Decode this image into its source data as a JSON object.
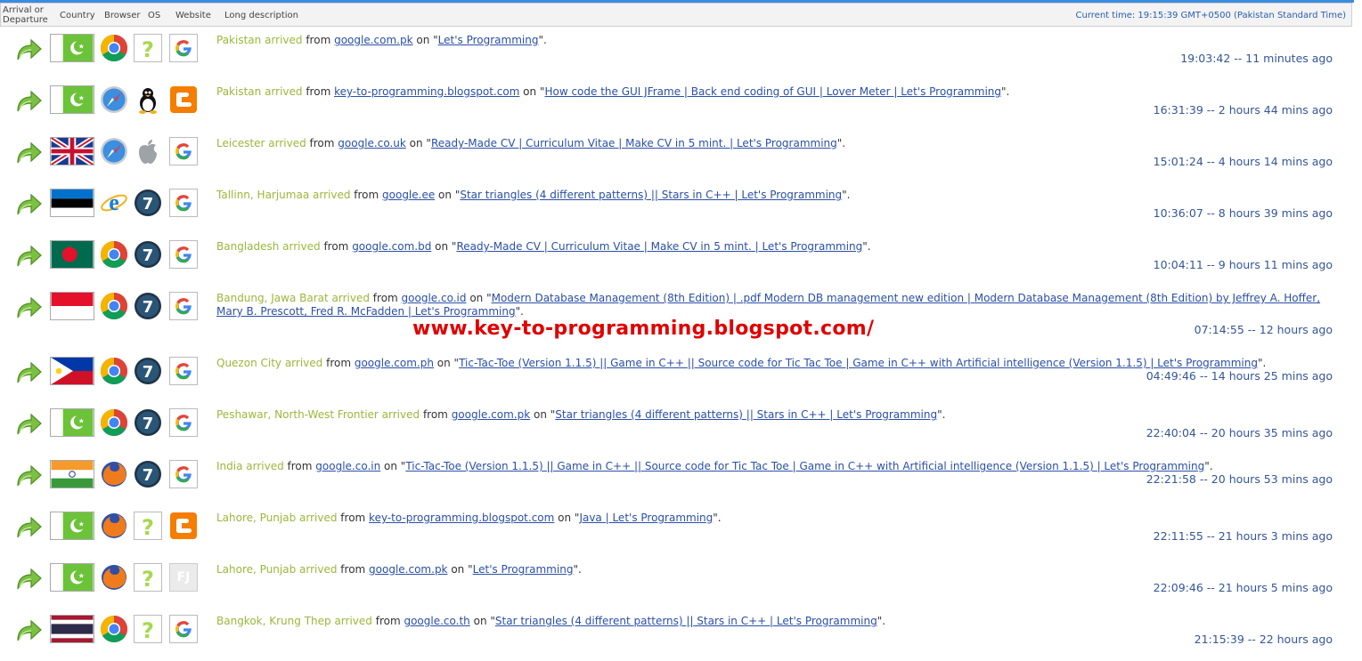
{
  "header": {
    "col_arrival": "Arrival or Departure",
    "col_country": "Country",
    "col_browser": "Browser",
    "col_os": "OS",
    "col_website": "Website",
    "col_description": "Long description",
    "current_time": "Current time: 19:15:39 GMT+0500 (Pakistan Standard Time)"
  },
  "watermark": "www.key-to-programming.blogspot.com/",
  "strings": {
    "arrived": " arrived",
    "from": " from ",
    "on": " on ",
    "quote_open": "\"",
    "quote_close": "\"."
  },
  "colors": {
    "location": "#9ab83a",
    "link": "#2a4fa8",
    "time": "#34559a",
    "watermark": "#e00000"
  },
  "rows": [
    {
      "location": "Pakistan",
      "flag": "pakistan-flag",
      "browser": "chrome-icon",
      "os": "unknown-icon",
      "site": "google-icon",
      "referrer": "google.com.pk",
      "page": "Let's Programming",
      "time": "19:03:42 -- 11 minutes ago"
    },
    {
      "location": "Pakistan",
      "flag": "pakistan-flag",
      "browser": "safari-icon",
      "os": "linux-icon",
      "site": "blogger-icon",
      "referrer": "key-to-programming.blogspot.com",
      "page": "How code the GUI JFrame | Back end coding of GUI | Lover Meter | Let's Programming",
      "time": "16:31:39 -- 2 hours 44 mins ago"
    },
    {
      "location": "Leicester",
      "flag": "uk-flag",
      "browser": "safari-icon",
      "os": "apple-icon",
      "site": "google-icon",
      "referrer": "google.co.uk",
      "page": "Ready-Made CV | Curriculum Vitae | Make CV in 5 mint. | Let's Programming",
      "time": "15:01:24 -- 4 hours 14 mins ago"
    },
    {
      "location": "Tallinn, Harjumaa",
      "flag": "estonia-flag",
      "browser": "ie-icon",
      "os": "windows7-icon",
      "site": "google-icon",
      "referrer": "google.ee",
      "page": "Star triangles (4 different patterns) || Stars in C++ | Let's Programming",
      "time": "10:36:07 -- 8 hours 39 mins ago"
    },
    {
      "location": "Bangladesh",
      "flag": "bangladesh-flag",
      "browser": "chrome-icon",
      "os": "windows7-icon",
      "site": "google-icon",
      "referrer": "google.com.bd",
      "page": "Ready-Made CV | Curriculum Vitae | Make CV in 5 mint. | Let's Programming",
      "time": "10:04:11 -- 9 hours 11 mins ago"
    },
    {
      "location": "Bandung, Jawa Barat",
      "flag": "indonesia-flag",
      "browser": "chrome-icon",
      "os": "windows7-icon",
      "site": "google-icon",
      "referrer": "google.co.id",
      "page": "Modern Database Management (8th Edition) | .pdf Modern DB management new edition | Modern Database Management (8th Edition) by Jeffrey A. Hoffer, Mary B. Prescott, Fred R. McFadden | Let's Programming",
      "time": "07:14:55 -- 12 hours ago"
    },
    {
      "location": "Quezon City",
      "flag": "philippines-flag",
      "browser": "chrome-icon",
      "os": "windows7-icon",
      "site": "google-icon",
      "referrer": "google.com.ph",
      "page": "Tic-Tac-Toe (Version 1.1.5) || Game in C++ || Source code for Tic Tac Toe | Game in C++ with Artificial intelligence (Version 1.1.5) | Let's Programming",
      "time": "04:49:46 -- 14 hours 25 mins ago"
    },
    {
      "location": "Peshawar, North-West Frontier",
      "flag": "pakistan-flag",
      "browser": "chrome-icon",
      "os": "windows7-icon",
      "site": "google-icon",
      "referrer": "google.com.pk",
      "page": "Star triangles (4 different patterns) || Stars in C++ | Let's Programming",
      "time": "22:40:04 -- 20 hours 35 mins ago"
    },
    {
      "location": "India",
      "flag": "india-flag",
      "browser": "firefox-icon",
      "os": "windows7-icon",
      "site": "google-icon",
      "referrer": "google.co.in",
      "page": "Tic-Tac-Toe (Version 1.1.5) || Game in C++ || Source code for Tic Tac Toe | Game in C++ with Artificial intelligence (Version 1.1.5) | Let's Programming",
      "time": "22:21:58 -- 20 hours 53 mins ago"
    },
    {
      "location": "Lahore, Punjab",
      "flag": "pakistan-flag",
      "browser": "firefox-icon",
      "os": "unknown-icon",
      "site": "blogger-icon",
      "referrer": "key-to-programming.blogspot.com",
      "page": "Java | Let's Programming",
      "time": "22:11:55 -- 21 hours 3 mins ago"
    },
    {
      "location": "Lahore, Punjab",
      "flag": "pakistan-flag",
      "browser": "firefox-icon",
      "os": "unknown-icon",
      "site": "fj-icon",
      "site_text": "FJ",
      "referrer": "google.com.pk",
      "page": "Let's Programming",
      "time": "22:09:46 -- 21 hours 5 mins ago"
    },
    {
      "location": "Bangkok, Krung Thep",
      "flag": "thailand-flag",
      "browser": "chrome-icon",
      "os": "unknown-icon",
      "site": "google-icon",
      "referrer": "google.co.th",
      "page": "Star triangles (4 different patterns) || Stars in C++ | Let's Programming",
      "time": "21:15:39 -- 22 hours ago"
    }
  ]
}
